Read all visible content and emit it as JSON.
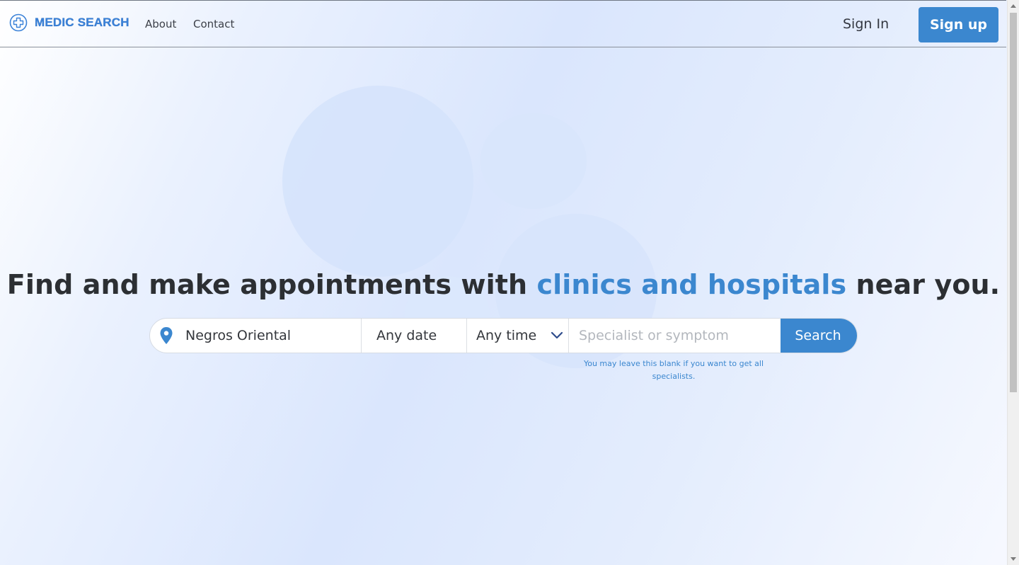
{
  "brand": {
    "name": "MEDIC SEARCH",
    "icon": "medical-cross-icon",
    "color": "#3b82d8"
  },
  "nav": {
    "links": [
      {
        "label": "About"
      },
      {
        "label": "Contact"
      }
    ],
    "signin_label": "Sign In",
    "signup_label": "Sign up"
  },
  "hero": {
    "headline_before": "Find and make appointments with ",
    "headline_accent": "clinics and hospitals",
    "headline_after": " near you.",
    "accent_color": "#3b87cf"
  },
  "search": {
    "location_value": "Negros Oriental",
    "location_icon": "location-pin-icon",
    "date_value": "Any date",
    "time_value": "Any time",
    "time_icon": "chevron-down-icon",
    "symptom_placeholder": "Specialist or symptom",
    "button_label": "Search",
    "hint": "You may leave this blank if you want to get all specialists."
  }
}
